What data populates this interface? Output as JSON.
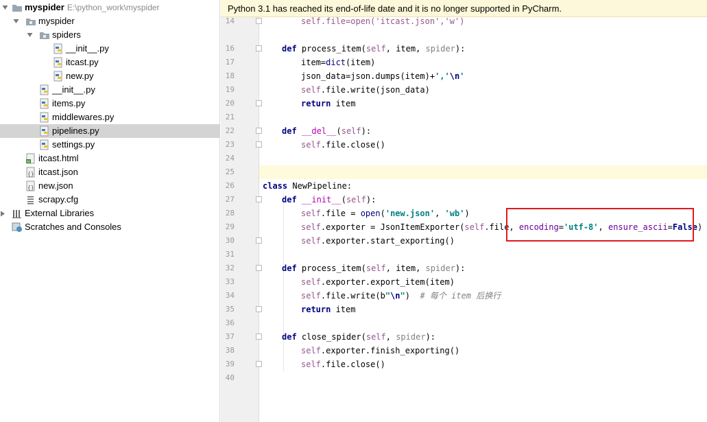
{
  "project": {
    "root_name": "myspider",
    "root_path": "E:\\python_work\\myspider",
    "tree": [
      {
        "label": "myspider",
        "icon": "folder-icon",
        "indent": 1,
        "expanded": true
      },
      {
        "label": "spiders",
        "icon": "folder-icon",
        "indent": 2,
        "expanded": true
      },
      {
        "label": "__init__.py",
        "icon": "python-file-icon",
        "indent": 3
      },
      {
        "label": "itcast.py",
        "icon": "python-file-icon",
        "indent": 3
      },
      {
        "label": "new.py",
        "icon": "python-file-icon",
        "indent": 3
      },
      {
        "label": "__init__.py",
        "icon": "python-file-icon",
        "indent": 2
      },
      {
        "label": "items.py",
        "icon": "python-file-icon",
        "indent": 2
      },
      {
        "label": "middlewares.py",
        "icon": "python-file-icon",
        "indent": 2
      },
      {
        "label": "pipelines.py",
        "icon": "python-file-icon",
        "indent": 2,
        "selected": true
      },
      {
        "label": "settings.py",
        "icon": "python-file-icon",
        "indent": 2
      },
      {
        "label": "itcast.html",
        "icon": "html-file-icon",
        "indent": 1
      },
      {
        "label": "itcast.json",
        "icon": "json-file-icon",
        "indent": 1
      },
      {
        "label": "new.json",
        "icon": "json-file-icon",
        "indent": 1
      },
      {
        "label": "scrapy.cfg",
        "icon": "config-file-icon",
        "indent": 1
      }
    ],
    "external_libraries": "External Libraries",
    "scratches": "Scratches and Consoles"
  },
  "editor": {
    "banner": "Python 3.1 has reached its end-of-life date and it is no longer supported in PyCharm.",
    "line_numbers": [
      "14",
      "16",
      "17",
      "18",
      "19",
      "20",
      "21",
      "22",
      "23",
      "24",
      "25",
      "26",
      "27",
      "28",
      "29",
      "30",
      "31",
      "32",
      "33",
      "34",
      "35",
      "36",
      "37",
      "38",
      "39",
      "40"
    ],
    "code": {
      "l14": "self.file=open('itcast.json','w')",
      "l16_def": "def",
      "l16_name": " process_item(",
      "l16_self": "self",
      "l16_rest1": ", item, ",
      "l16_spider": "spider",
      "l16_end": "):",
      "l17_a": "item=",
      "l17_b": "dict",
      "l17_c": "(item)",
      "l18_a": "json_data=json.dumps(item)+",
      "l18_str": "','",
      "l18_esc": "\\n",
      "l18_q": "'",
      "l19_self": "self",
      "l19_rest": ".file.write(json_data)",
      "l20_kw": "return",
      "l20_rest": " item",
      "l22_def": "def",
      "l22_name": "__del__",
      "l22_open": "(",
      "l22_self": "self",
      "l22_end": "):",
      "l23_self": "self",
      "l23_rest": ".file.close()",
      "l26_kw": "class",
      "l26_rest": " NewPipeline:",
      "l27_def": "def",
      "l27_name": "__init__",
      "l27_open": "(",
      "l27_self": "self",
      "l27_end": "):",
      "l28_self": "self",
      "l28_rest": ".file = ",
      "l28_open": "open",
      "l28_paren": "(",
      "l28_s1": "'new.json'",
      "l28_comma": ", ",
      "l28_s2": "'wb'",
      "l28_end": ")",
      "l29_self": "self",
      "l29_rest": ".exporter = JsonItemExporter(",
      "l29_self2": "self",
      "l29_rest2": ".file, ",
      "l29_kw1": "encoding",
      "l29_eq": "=",
      "l29_s1": "'utf-8'",
      "l29_comma": ", ",
      "l29_kw2": "ensure_ascii",
      "l29_eq2": "=",
      "l29_false": "False",
      "l29_end": ")",
      "l30_self": "self",
      "l30_rest": ".exporter.start_exporting()",
      "l32_def": "def",
      "l32_name": " process_item(",
      "l32_self": "self",
      "l32_rest1": ", item, ",
      "l32_spider": "spider",
      "l32_end": "):",
      "l33_self": "self",
      "l33_rest": ".exporter.export_item(item)",
      "l34_self": "self",
      "l34_rest": ".file.write(b",
      "l34_q1": "\"",
      "l34_esc": "\\n",
      "l34_q2": "\"",
      "l34_end": ")  ",
      "l34_cmt": "# 每个 item 后换行",
      "l35_kw": "return",
      "l35_rest": " item",
      "l37_def": "def",
      "l37_name": " close_spider(",
      "l37_self": "self",
      "l37_rest1": ", ",
      "l37_spider": "spider",
      "l37_end": "):",
      "l38_self": "self",
      "l38_rest": ".exporter.finish_exporting()",
      "l39_self": "self",
      "l39_rest": ".file.close()"
    }
  },
  "colors": {
    "keyword": "#000080",
    "self": "#94558d",
    "string": "#008080",
    "highlight_box": "#e0191b",
    "banner_bg": "#fdf8d9",
    "selection": "#d4d4d4"
  }
}
